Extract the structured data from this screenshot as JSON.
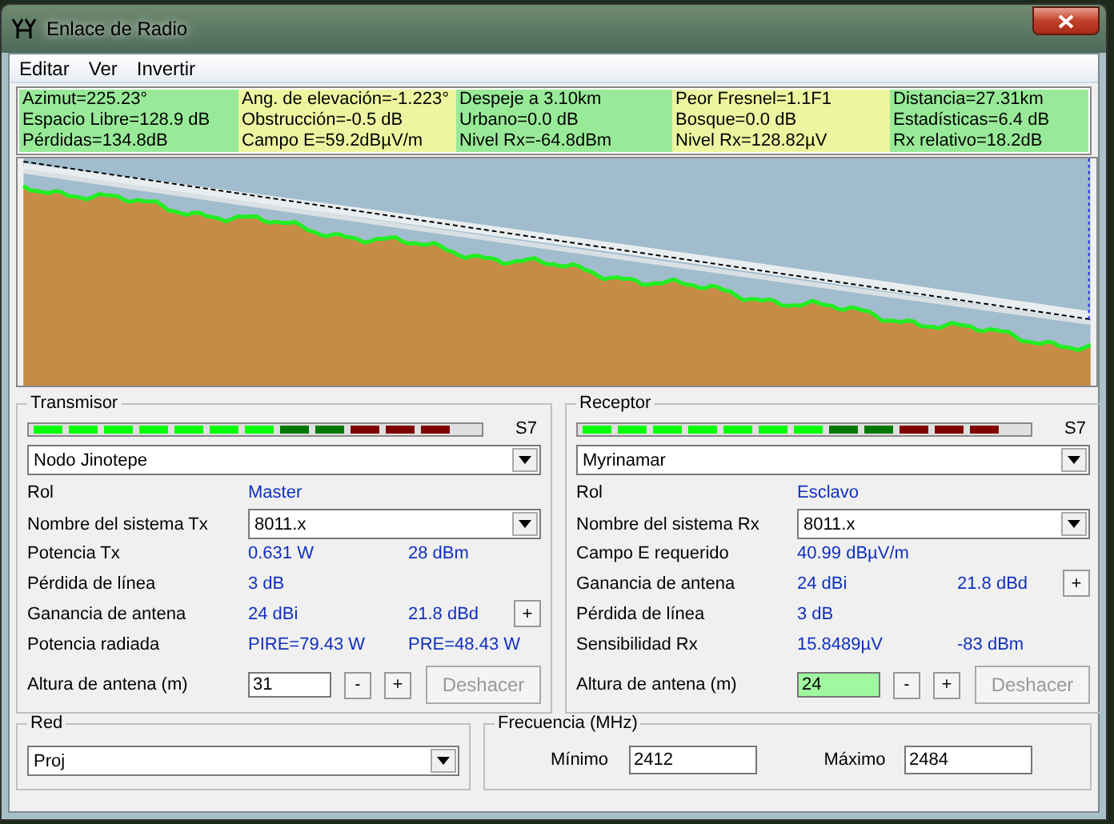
{
  "window": {
    "title": "Enlace de Radio"
  },
  "menu": [
    "Editar",
    "Ver",
    "Invertir"
  ],
  "stats": [
    [
      "Azimut=225.23°",
      "Ang. de elevación=-1.223°",
      "Despeje a 3.10km",
      "Peor Fresnel=1.1F1",
      "Distancia=27.31km"
    ],
    [
      "Espacio Libre=128.9 dB",
      "Obstrucción=-0.5 dB",
      "Urbano=0.0 dB",
      "Bosque=0.0 dB",
      "Estadísticas=6.4 dB"
    ],
    [
      "Pérdidas=134.8dB",
      "Campo E=59.2dBµV/m",
      "Nivel Rx=-64.8dBm",
      "Nivel Rx=128.82µV",
      "Rx relativo=18.2dB"
    ]
  ],
  "panels": [
    {
      "title": "Transmisor",
      "meter": {
        "segments": [
          {
            "color": "#00ff00"
          },
          {
            "color": "#00ff00"
          },
          {
            "color": "#00ff00"
          },
          {
            "color": "#00ff00"
          },
          {
            "color": "#00ff00"
          },
          {
            "color": "#00ff00"
          },
          {
            "color": "#00ff00"
          },
          {
            "color": "#007800"
          },
          {
            "color": "#007800"
          },
          {
            "color": "#800000"
          },
          {
            "color": "#800000"
          },
          {
            "color": "#800000"
          }
        ],
        "reading": "S7"
      },
      "unit": "Nodo Jinotepe",
      "rows": [
        {
          "kind": "text",
          "label": "Rol",
          "value": "Master"
        },
        {
          "kind": "select",
          "label": "Nombre del sistema Tx",
          "value": "8011.x"
        },
        {
          "kind": "text",
          "label": "Potencia Tx",
          "value": "0.631 W",
          "value2": "28 dBm"
        },
        {
          "kind": "text",
          "label": "Pérdida de línea",
          "value": "3 dB"
        },
        {
          "kind": "text",
          "label": "Ganancia de antena",
          "value": "24 dBi",
          "value2": "21.8 dBd",
          "button": "+"
        },
        {
          "kind": "text",
          "label": "Potencia radiada",
          "value": "PIRE=79.43 W",
          "value2": "PRE=48.43 W"
        }
      ],
      "height": {
        "label": "Altura de antena (m)",
        "value": "31",
        "highlighted": false,
        "buttons": [
          "-",
          "+"
        ],
        "undo": {
          "label": "Deshacer",
          "disabled": true
        }
      }
    },
    {
      "title": "Receptor",
      "meter": {
        "segments": [
          {
            "color": "#00ff00"
          },
          {
            "color": "#00ff00"
          },
          {
            "color": "#00ff00"
          },
          {
            "color": "#00ff00"
          },
          {
            "color": "#00ff00"
          },
          {
            "color": "#00ff00"
          },
          {
            "color": "#00ff00"
          },
          {
            "color": "#007800"
          },
          {
            "color": "#007800"
          },
          {
            "color": "#800000"
          },
          {
            "color": "#800000"
          },
          {
            "color": "#800000"
          }
        ],
        "reading": "S7"
      },
      "unit": "Myrinamar",
      "rows": [
        {
          "kind": "text",
          "label": "Rol",
          "value": "Esclavo"
        },
        {
          "kind": "select",
          "label": "Nombre del sistema Rx",
          "value": "8011.x"
        },
        {
          "kind": "text",
          "label": "Campo E requerido",
          "value": "40.99 dBµV/m"
        },
        {
          "kind": "text",
          "label": "Ganancia de antena",
          "value": "24 dBi",
          "value2": "21.8 dBd",
          "button": "+"
        },
        {
          "kind": "text",
          "label": "Pérdida de línea",
          "value": "3 dB"
        },
        {
          "kind": "text",
          "label": "Sensibilidad Rx",
          "value": "15.8489µV",
          "value2": "-83 dBm"
        }
      ],
      "height": {
        "label": "Altura de antena (m)",
        "value": "24",
        "highlighted": true,
        "buttons": [
          "-",
          "+"
        ],
        "undo": {
          "label": "Deshacer",
          "disabled": true
        }
      }
    }
  ],
  "network": {
    "title": "Red",
    "value": "Proj"
  },
  "frequency": {
    "title": "Frecuencia (MHz)",
    "fields": [
      {
        "label": "Mínimo",
        "value": "2412"
      },
      {
        "label": "Máximo",
        "value": "2484"
      }
    ]
  }
}
